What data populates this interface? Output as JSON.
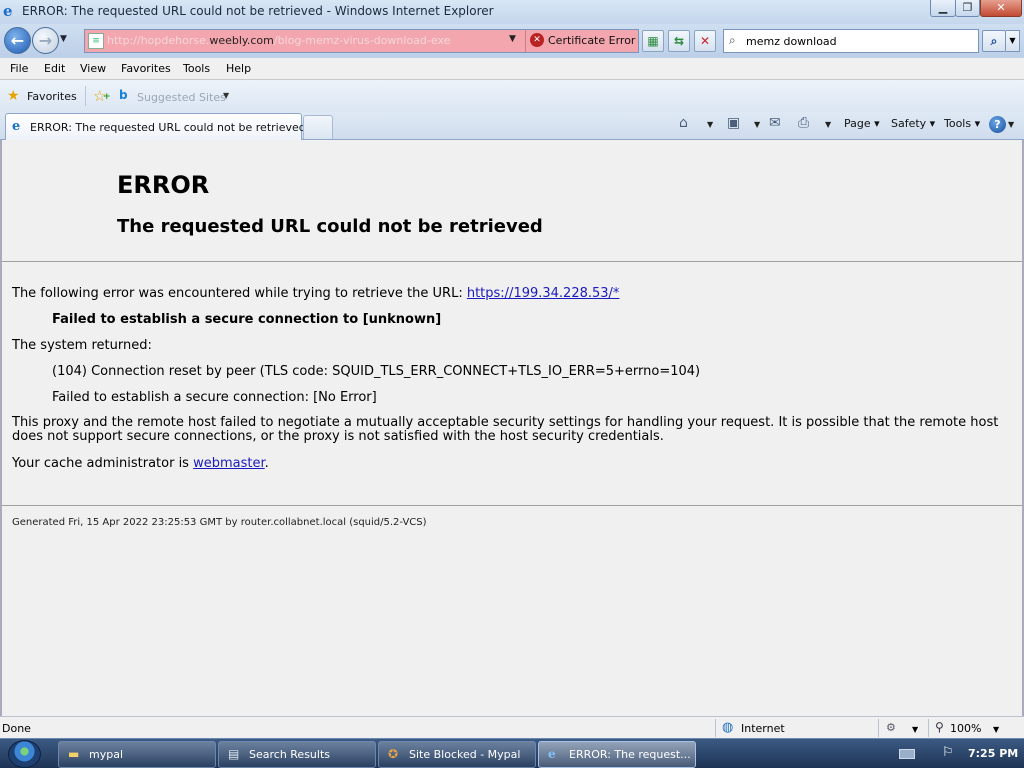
{
  "window": {
    "title": "ERROR: The requested URL could not be retrieved - Windows Internet Explorer"
  },
  "navbar": {
    "address_url_prefix": "http://hopdehorse.",
    "address_url_host": "weebly.com",
    "address_url_suffix": "/blog-memz-virus-download-exe",
    "cert_error_label": "Certificate Error",
    "search_value": "memz download"
  },
  "menubar": {
    "items": [
      "File",
      "Edit",
      "View",
      "Favorites",
      "Tools",
      "Help"
    ]
  },
  "favorites_bar": {
    "favorites_label": "Favorites",
    "suggested_sites_label": "Suggested Sites"
  },
  "tabs": {
    "active_label": "ERROR: The requested URL could not be retrieved"
  },
  "command_bar": {
    "page_label": "Page",
    "safety_label": "Safety",
    "tools_label": "Tools"
  },
  "page": {
    "error_title": "ERROR",
    "error_subtitle": "The requested URL could not be retrieved",
    "line1_text": "The following error was encountered while trying to retrieve the URL: ",
    "line1_url": "https://199.34.228.53/*",
    "failed_secure": "Failed to establish a secure connection to [unknown]",
    "system_returned": "The system returned:",
    "conn_reset": "(104) Connection reset by peer (TLS code: SQUID_TLS_ERR_CONNECT+TLS_IO_ERR=5+errno=104)",
    "failed_no_error": "Failed to establish a secure connection: [No Error]",
    "explanation": "This proxy and the remote host failed to negotiate a mutually acceptable security settings for handling your request. It is possible that the remote host does not support secure connections, or the proxy is not satisfied with the host security credentials.",
    "cache_admin_prefix": "Your cache administrator is ",
    "cache_admin_link": "webmaster",
    "cache_admin_suffix": ".",
    "footer_generated": "Generated Fri, 15 Apr 2022 23:25:53 GMT by router.collabnet.local (squid/5.2-VCS)"
  },
  "statusbar": {
    "status": "Done",
    "zone": "Internet",
    "zoom": "100%"
  },
  "taskbar": {
    "items": [
      {
        "label": "mypal",
        "icon": "folder-icon"
      },
      {
        "label": "Search Results",
        "icon": "search-results-icon"
      },
      {
        "label": "Site Blocked - Mypal",
        "icon": "mypal-icon"
      },
      {
        "label": "ERROR: The request...",
        "icon": "ie-icon"
      }
    ],
    "clock": "7:25 PM"
  },
  "colors": {
    "address_error_bg": "#f4a6ae",
    "link": "#1b1bbd",
    "page_bg": "#f0f0f0"
  }
}
